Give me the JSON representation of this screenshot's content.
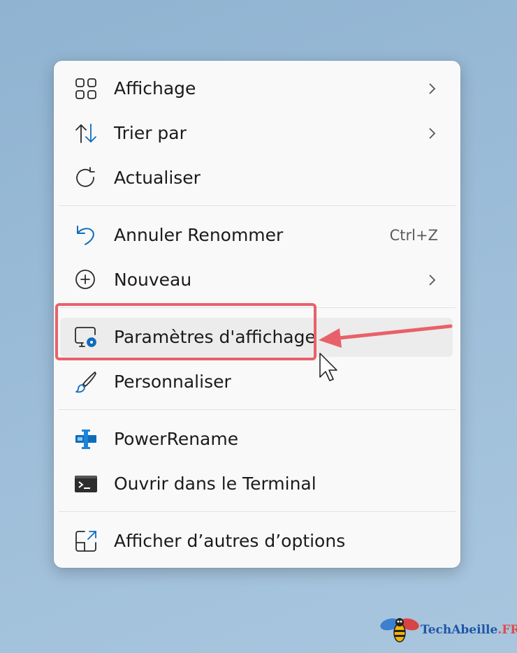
{
  "menu": {
    "items": [
      {
        "label": "Affichage",
        "icon": "grid-icon",
        "submenu": true
      },
      {
        "label": "Trier par",
        "icon": "sort-icon",
        "submenu": true
      },
      {
        "label": "Actualiser",
        "icon": "refresh-icon"
      },
      {
        "label": "Annuler Renommer",
        "icon": "undo-icon",
        "shortcut": "Ctrl+Z"
      },
      {
        "label": "Nouveau",
        "icon": "plus-circle-icon",
        "submenu": true
      },
      {
        "label": "Paramètres d'affichage",
        "icon": "display-settings-icon",
        "highlighted": true
      },
      {
        "label": "Personnaliser",
        "icon": "brush-icon"
      },
      {
        "label": "PowerRename",
        "icon": "powerrename-icon"
      },
      {
        "label": "Ouvrir dans le Terminal",
        "icon": "terminal-icon"
      },
      {
        "label": "Afficher d’autres d’options",
        "icon": "expand-icon"
      }
    ]
  },
  "watermark": {
    "brand": "TechAbeille",
    "tld": ".FR",
    "icon": "bee-logo"
  },
  "colors": {
    "accent": "#0f6cbd",
    "annotation": "#e8616a"
  }
}
